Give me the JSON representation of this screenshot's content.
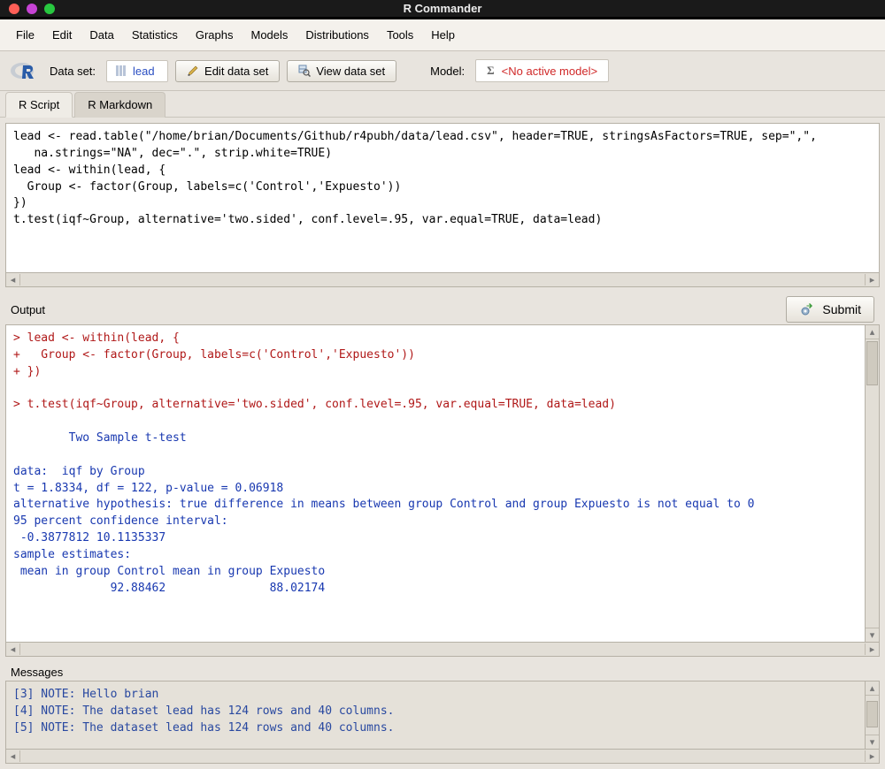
{
  "titlebar": {
    "title": "R Commander"
  },
  "menu": {
    "items": [
      "File",
      "Edit",
      "Data",
      "Statistics",
      "Graphs",
      "Models",
      "Distributions",
      "Tools",
      "Help"
    ]
  },
  "toolbar": {
    "dataset_label": "Data set:",
    "dataset_name": "lead",
    "edit_btn": "Edit data set",
    "view_btn": "View data set",
    "model_label": "Model:",
    "model_value": "<No active model>"
  },
  "tabs": {
    "script": "R Script",
    "rmd": "R Markdown"
  },
  "script_text": "lead <- read.table(\"/home/brian/Documents/Github/r4pubh/data/lead.csv\", header=TRUE, stringsAsFactors=TRUE, sep=\",\", \n   na.strings=\"NA\", dec=\".\", strip.white=TRUE)\nlead <- within(lead, {\n  Group <- factor(Group, labels=c('Control','Expuesto'))\n})\nt.test(iqf~Group, alternative='two.sided', conf.level=.95, var.equal=TRUE, data=lead)",
  "output": {
    "label": "Output",
    "submit_label": "Submit",
    "cmd1_l1": "> lead <- within(lead, {",
    "cmd1_l2": "+   Group <- factor(Group, labels=c('Control','Expuesto'))",
    "cmd1_l3": "+ })",
    "cmd2": "> t.test(iqf~Group, alternative='two.sided', conf.level=.95, var.equal=TRUE, data=lead)",
    "res_title": "\tTwo Sample t-test",
    "res_data": "data:  iqf by Group",
    "res_t": "t = 1.8334, df = 122, p-value = 0.06918",
    "res_alt": "alternative hypothesis: true difference in means between group Control and group Expuesto is not equal to 0",
    "res_ci_lbl": "95 percent confidence interval:",
    "res_ci_val": " -0.3877812 10.1135337",
    "res_est_lbl": "sample estimates:",
    "res_est_hdr": " mean in group Control mean in group Expuesto ",
    "res_est_val": "              92.88462               88.02174 "
  },
  "messages": {
    "label": "Messages",
    "l1": "[3] NOTE: Hello brian",
    "l2": "[4] NOTE: The dataset lead has 124 rows and 40 columns.",
    "l3": "[5] NOTE: The dataset lead has 124 rows and 40 columns."
  }
}
